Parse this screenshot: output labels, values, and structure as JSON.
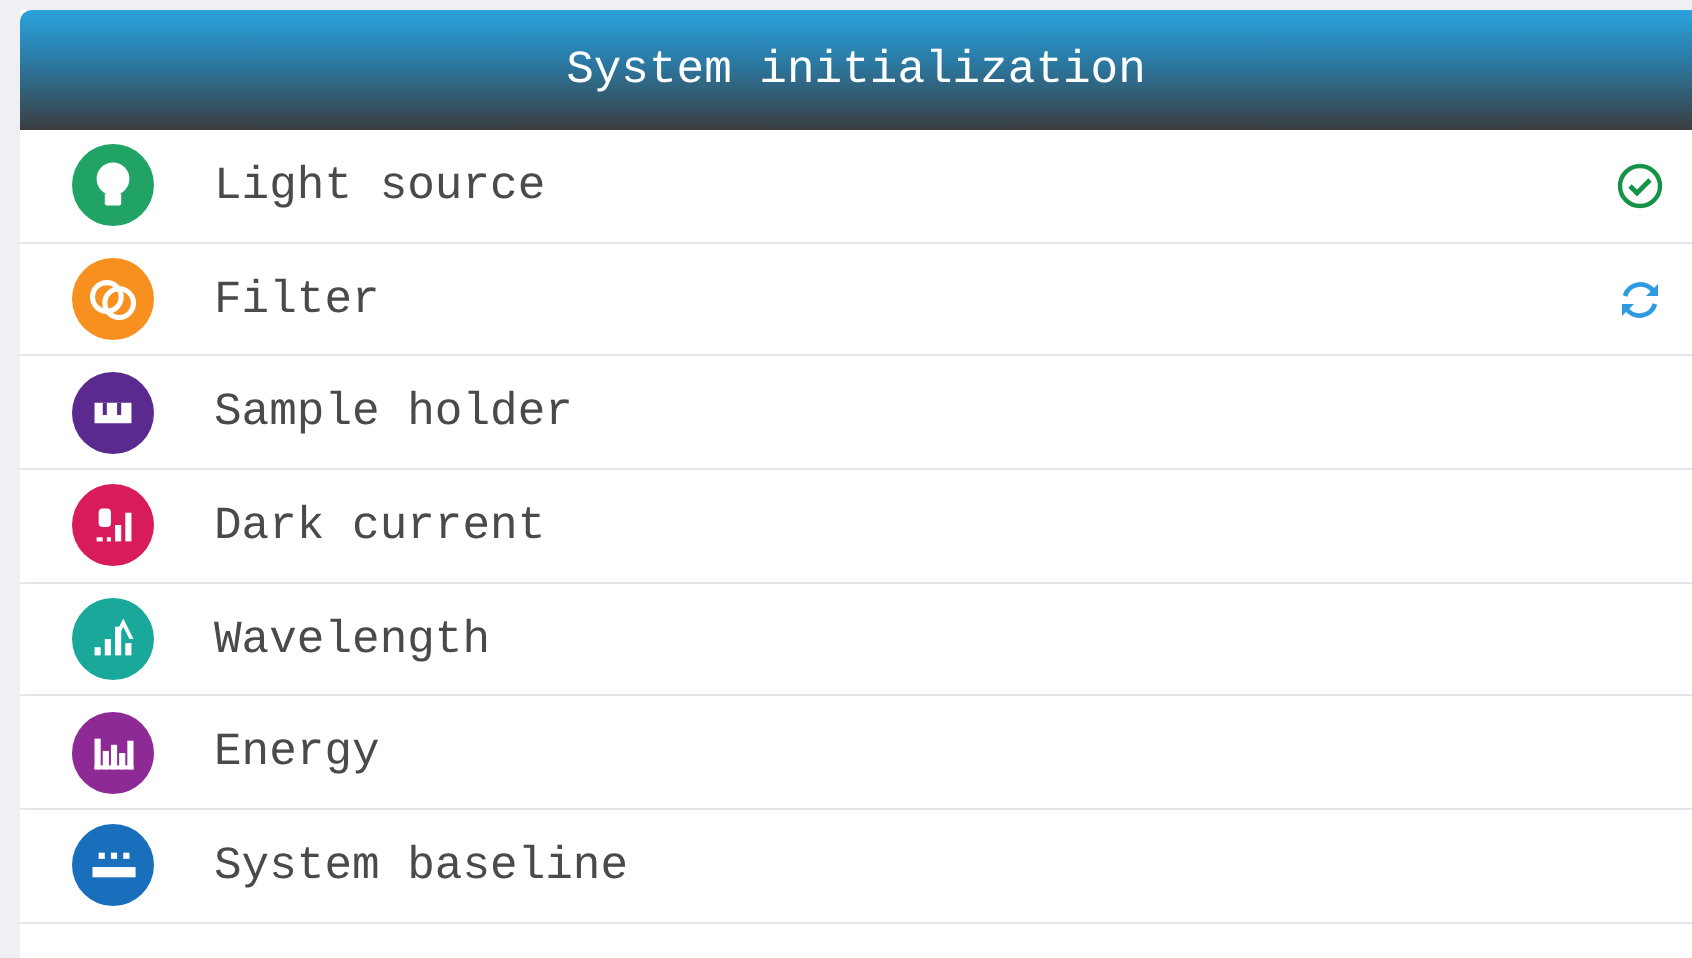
{
  "header": {
    "title": "System initialization"
  },
  "items": [
    {
      "label": "Light source",
      "kind": "bulb",
      "color": "#21a366",
      "complete": true,
      "in_progress": false
    },
    {
      "label": "Filter",
      "kind": "filter",
      "color": "#f7901e",
      "complete": false,
      "in_progress": true
    },
    {
      "label": "Sample holder",
      "kind": "holder",
      "color": "#5b2a8e",
      "complete": false,
      "in_progress": false
    },
    {
      "label": "Dark current",
      "kind": "dark",
      "color": "#d81b5a",
      "complete": false,
      "in_progress": false
    },
    {
      "label": "Wavelength",
      "kind": "wave",
      "color": "#1aa89a",
      "complete": false,
      "in_progress": false
    },
    {
      "label": "Energy",
      "kind": "energy",
      "color": "#8e2a96",
      "complete": false,
      "in_progress": false
    },
    {
      "label": "System baseline",
      "kind": "baseline",
      "color": "#1a6fbd",
      "complete": false,
      "in_progress": false
    }
  ]
}
